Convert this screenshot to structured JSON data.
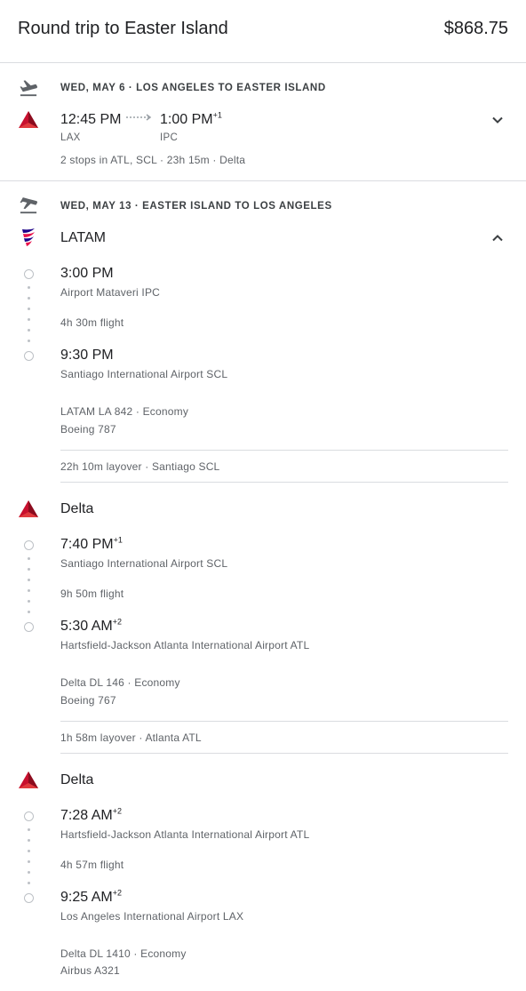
{
  "header": {
    "title": "Round trip to Easter Island",
    "price": "$868.75"
  },
  "outbound": {
    "heading": "WED, MAY 6 · LOS ANGELES TO EASTER ISLAND",
    "depart_time": "12:45 PM",
    "arrive_time": "1:00 PM",
    "arrive_offset": "+1",
    "depart_code": "LAX",
    "arrive_code": "IPC",
    "summary": "2 stops in ATL, SCL · 23h 15m · Delta",
    "icons": {
      "plane": "takeoff-plane-icon",
      "airline": "delta-logo-icon",
      "toggle": "chevron-down-icon"
    },
    "colors": {
      "delta": "#c8102e"
    }
  },
  "return": {
    "heading": "WED, MAY 13 · EASTER ISLAND TO LOS ANGELES",
    "icons": {
      "plane": "landing-plane-icon",
      "toggle": "chevron-up-icon"
    },
    "segments": [
      {
        "airline": "LATAM",
        "airline_icon": "latam-logo-icon",
        "depart_time": "3:00 PM",
        "depart_offset": "",
        "depart_airport": "Airport Mataveri IPC",
        "duration": "4h 30m flight",
        "arrive_time": "9:30 PM",
        "arrive_offset": "",
        "arrive_airport": "Santiago International Airport SCL",
        "flight": "LATAM LA 842 · Economy",
        "aircraft": "Boeing 787",
        "layover": "22h 10m layover · Santiago SCL"
      },
      {
        "airline": "Delta",
        "airline_icon": "delta-logo-icon",
        "depart_time": "7:40 PM",
        "depart_offset": "+1",
        "depart_airport": "Santiago International Airport SCL",
        "duration": "9h 50m flight",
        "arrive_time": "5:30 AM",
        "arrive_offset": "+2",
        "arrive_airport": "Hartsfield-Jackson Atlanta International Airport ATL",
        "flight": "Delta DL 146 · Economy",
        "aircraft": "Boeing 767",
        "layover": "1h 58m layover · Atlanta ATL"
      },
      {
        "airline": "Delta",
        "airline_icon": "delta-logo-icon",
        "depart_time": "7:28 AM",
        "depart_offset": "+2",
        "depart_airport": "Hartsfield-Jackson Atlanta International Airport ATL",
        "duration": "4h 57m flight",
        "arrive_time": "9:25 AM",
        "arrive_offset": "+2",
        "arrive_airport": "Los Angeles International Airport LAX",
        "flight": "Delta DL 1410 · Economy",
        "aircraft": "Airbus A321"
      }
    ]
  }
}
